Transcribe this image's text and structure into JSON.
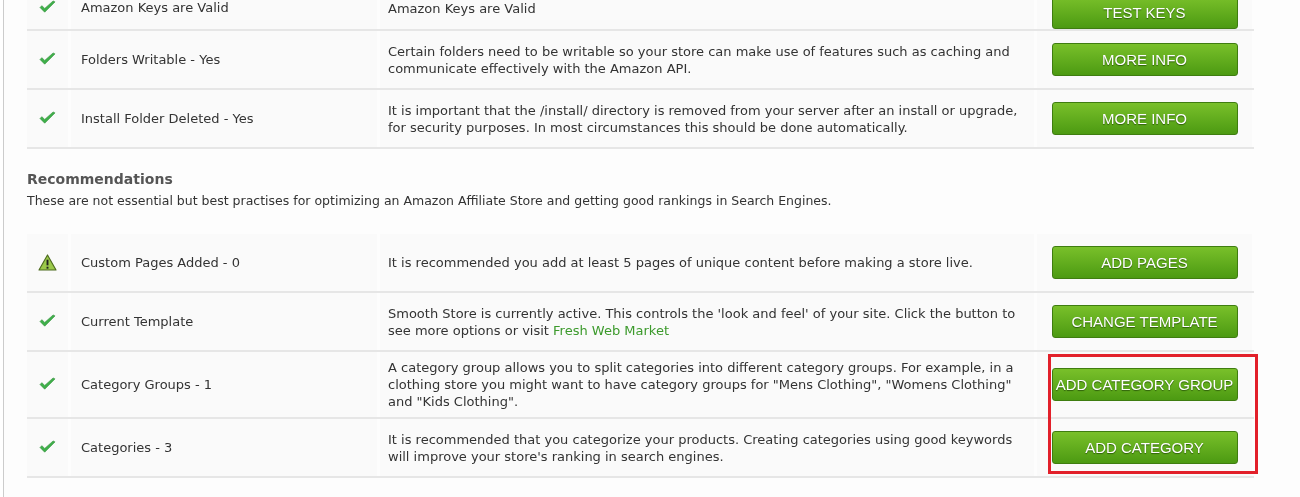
{
  "checks": [
    {
      "kind": "ok",
      "label": "Amazon Keys are Valid",
      "description": "Amazon Keys are Valid",
      "button": "TEST KEYS",
      "highlighted": false
    },
    {
      "kind": "ok",
      "label": "Folders Writable - Yes",
      "description": "Certain folders need to be writable so your store can make use of features such as caching and communicate effectively with the Amazon API.",
      "button": "MORE INFO",
      "highlighted": false
    },
    {
      "kind": "ok",
      "label": "Install Folder Deleted - Yes",
      "description": "It is important that the /install/ directory is removed from your server after an install or upgrade, for security purposes. In most circumstances this should be done automatically.",
      "button": "MORE INFO",
      "highlighted": false
    }
  ],
  "recommendations": {
    "title": "Recommendations",
    "intro": "These are not essential but best practises for optimizing an Amazon Affiliate Store and getting good rankings in Search Engines.",
    "rows": [
      {
        "kind": "warning",
        "label": "Custom Pages Added - 0",
        "description": "It is recommended you add at least 5 pages of unique content before making a store live.",
        "button": "ADD PAGES",
        "highlighted": false
      },
      {
        "kind": "ok",
        "label": "Current Template",
        "description": "Smooth Store is currently active. This controls the 'look and feel' of your site. Click the button to see more options or visit ",
        "link": "Fresh Web Market",
        "button": "CHANGE TEMPLATE",
        "highlighted": false
      },
      {
        "kind": "ok",
        "label": "Category Groups - 1",
        "description": "A category group allows you to split categories into different category groups. For example, in a clothing store you might want to have category groups for \"Mens Clothing\", \"Womens Clothing\" and \"Kids Clothing\".",
        "button": "ADD CATEGORY GROUP",
        "highlighted": true
      },
      {
        "kind": "ok",
        "label": "Categories - 3",
        "description": "It is recommended that you categorize your products. Creating categories using good keywords will improve your store's ranking in search engines.",
        "button": "ADD CATEGORY",
        "highlighted": true
      }
    ]
  }
}
